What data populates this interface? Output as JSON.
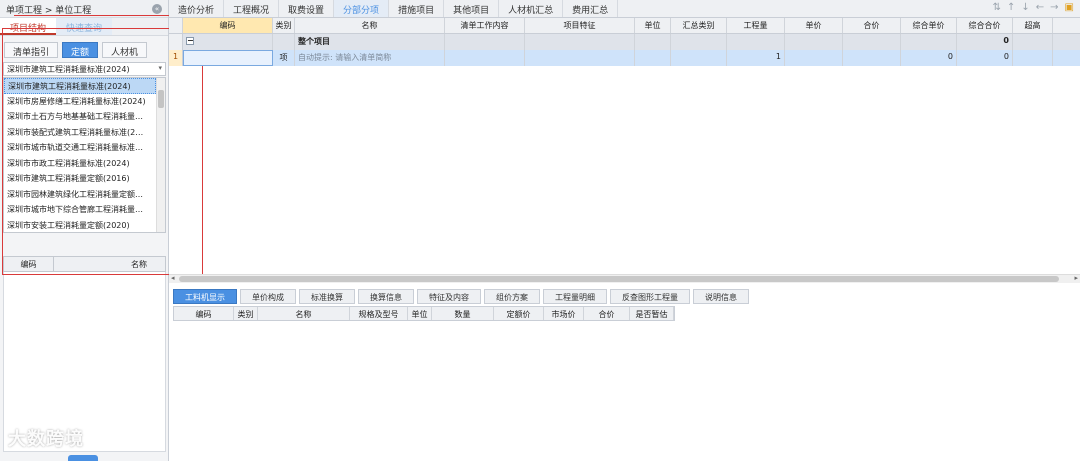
{
  "breadcrumb": "单项工程 > 单位工程",
  "left_tabs": [
    "项目结构",
    "快速查询"
  ],
  "sub_tabs": [
    "清单指引",
    "定额",
    "人材机"
  ],
  "quota_select": "深圳市建筑工程消耗量标准(2024)",
  "quota_list": [
    "深圳市建筑工程消耗量标准(2024)",
    "深圳市房屋修缮工程消耗量标准(2024)",
    "深圳市土石方与地基基础工程消耗量…",
    "深圳市装配式建筑工程消耗量标准(2…",
    "深圳市城市轨道交通工程消耗量标准…",
    "深圳市市政工程消耗量标准(2024)",
    "深圳市建筑工程消耗量定额(2016)",
    "深圳市园林建筑绿化工程消耗量定额…",
    "深圳市城市地下综合管廊工程消耗量…",
    "深圳市安装工程消耗量定额(2020)"
  ],
  "code_table_headers": [
    "编码",
    "名称"
  ],
  "menu": [
    "造价分析",
    "工程概况",
    "取费设置",
    "分部分项",
    "措施项目",
    "其他项目",
    "人材机汇总",
    "费用汇总"
  ],
  "grid": {
    "headers": [
      "编码",
      "类别",
      "名称",
      "清单工作内容",
      "项目特征",
      "单位",
      "汇总类别",
      "工程量",
      "单价",
      "合价",
      "综合单价",
      "综合合价",
      "超高"
    ],
    "total_row": {
      "name": "整个项目",
      "amount": "0"
    },
    "item_row": {
      "index": "1",
      "type": "项",
      "hint": "自动提示: 请输入清单简称",
      "quantity": "1",
      "unit_price": "0",
      "total": "0"
    }
  },
  "bottom_tabs": [
    "工料机显示",
    "单价构成",
    "标准换算",
    "换算信息",
    "特征及内容",
    "组价方案",
    "工程量明细",
    "反查图形工程量",
    "说明信息"
  ],
  "bottom_headers": [
    "编码",
    "类别",
    "名称",
    "规格及型号",
    "单位",
    "数量",
    "定额价",
    "市场价",
    "合价",
    "是否暂估"
  ],
  "watermark": "大数跨境"
}
